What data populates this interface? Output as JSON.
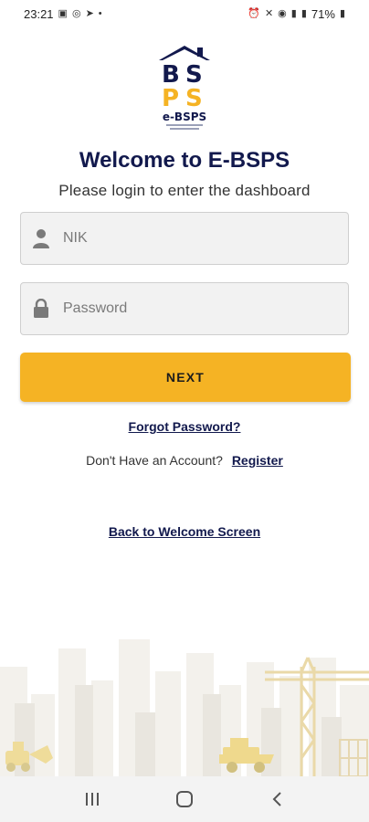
{
  "status_bar": {
    "time": "23:21",
    "battery": "71%",
    "left_icons": [
      "gallery-icon",
      "whatsapp-icon",
      "telegram-icon",
      "dot-icon"
    ],
    "right_icons": [
      "alarm-icon",
      "mute-icon",
      "wifi-icon",
      "signal-icon",
      "signal-icon",
      "battery-icon"
    ]
  },
  "header": {
    "logo_text": "e-BSPS",
    "title": "Welcome to E-BSPS",
    "subtitle": "Please login to enter the dashboard"
  },
  "form": {
    "nik_placeholder": "NIK",
    "password_placeholder": "Password",
    "next_label": "NEXT"
  },
  "links": {
    "forgot_password": "Forgot Password?",
    "no_account_text": "Don't Have an Account?",
    "register": "Register",
    "back_to_welcome": "Back to Welcome Screen"
  },
  "colors": {
    "primary_navy": "#12194d",
    "accent_yellow": "#f5b324",
    "field_bg": "#f2f2f2"
  }
}
